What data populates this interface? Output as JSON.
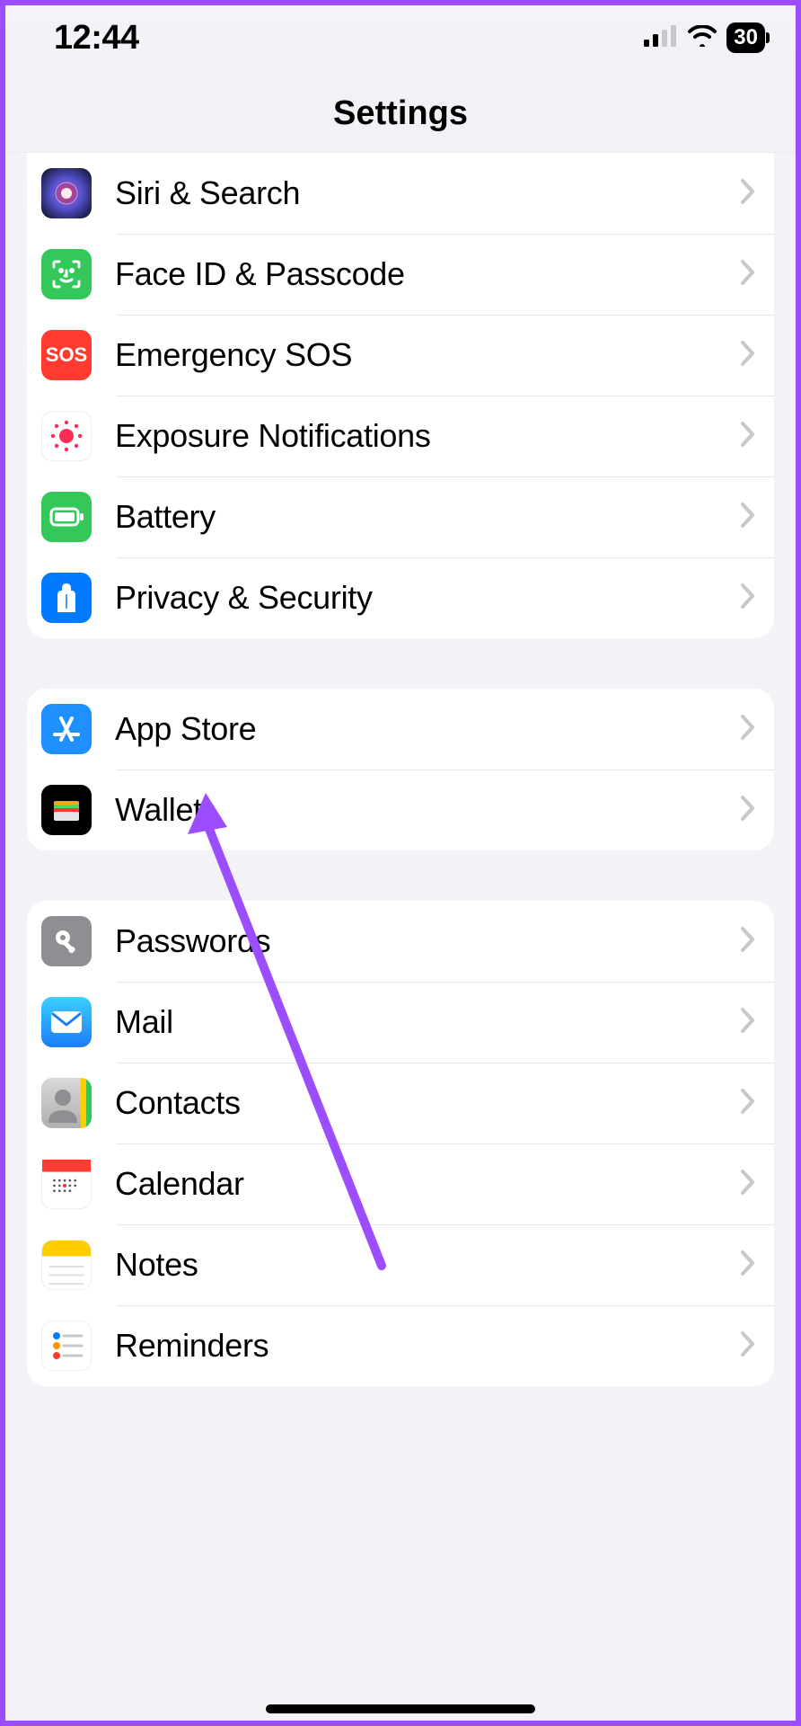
{
  "status": {
    "time": "12:44",
    "battery_pct": "30"
  },
  "header": {
    "title": "Settings"
  },
  "groups": [
    {
      "rows": [
        {
          "id": "siri",
          "label": "Siri & Search",
          "icon": "siri-icon"
        },
        {
          "id": "faceid",
          "label": "Face ID & Passcode",
          "icon": "faceid-icon"
        },
        {
          "id": "sos",
          "label": "Emergency SOS",
          "icon": "sos-icon"
        },
        {
          "id": "exposure",
          "label": "Exposure Notifications",
          "icon": "exposure-icon"
        },
        {
          "id": "battery",
          "label": "Battery",
          "icon": "battery-icon"
        },
        {
          "id": "privacy",
          "label": "Privacy & Security",
          "icon": "privacy-icon"
        }
      ]
    },
    {
      "rows": [
        {
          "id": "appstore",
          "label": "App Store",
          "icon": "appstore-icon"
        },
        {
          "id": "wallet",
          "label": "Wallet",
          "icon": "wallet-icon"
        }
      ]
    },
    {
      "rows": [
        {
          "id": "passwords",
          "label": "Passwords",
          "icon": "passwords-icon"
        },
        {
          "id": "mail",
          "label": "Mail",
          "icon": "mail-icon"
        },
        {
          "id": "contacts",
          "label": "Contacts",
          "icon": "contacts-icon"
        },
        {
          "id": "calendar",
          "label": "Calendar",
          "icon": "calendar-icon"
        },
        {
          "id": "notes",
          "label": "Notes",
          "icon": "notes-icon"
        },
        {
          "id": "reminders",
          "label": "Reminders",
          "icon": "reminders-icon"
        }
      ]
    }
  ],
  "annotation": {
    "type": "arrow",
    "target": "privacy"
  }
}
